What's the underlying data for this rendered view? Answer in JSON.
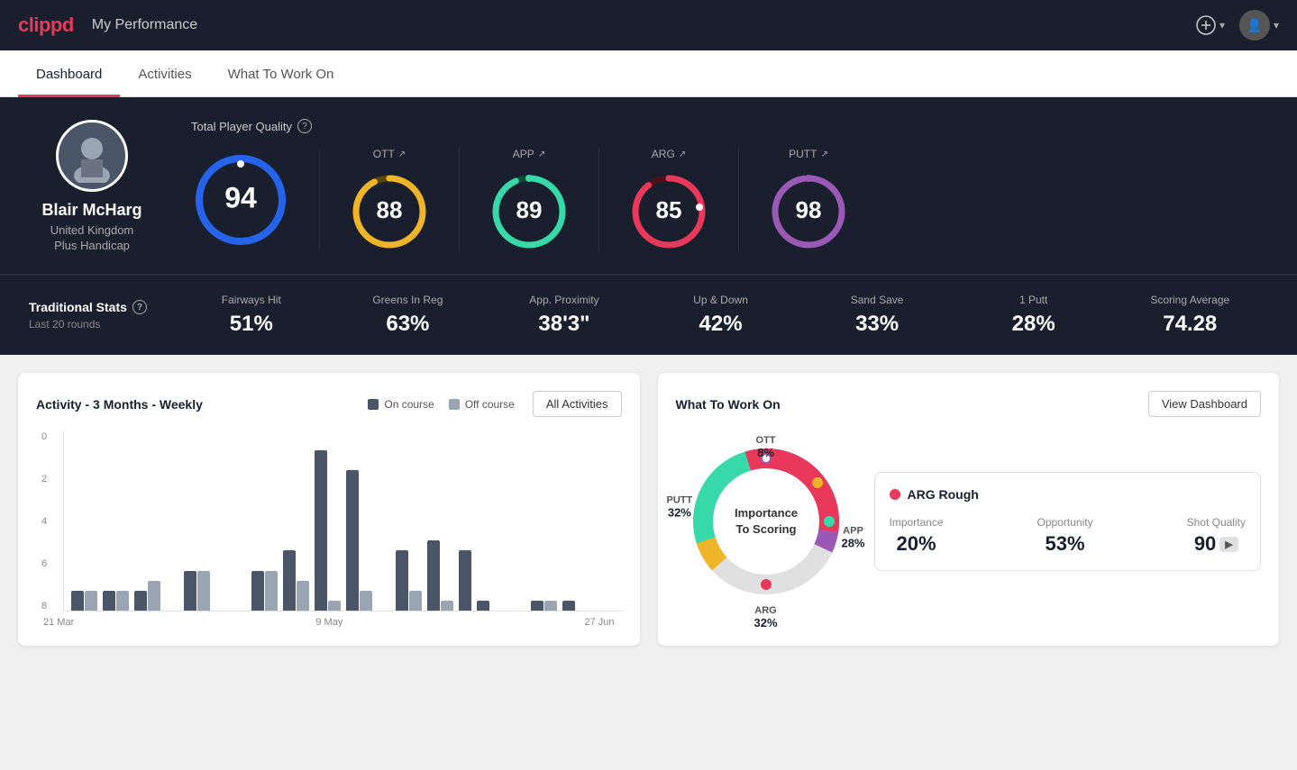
{
  "app": {
    "logo": "clippd",
    "header_title": "My Performance"
  },
  "tabs": [
    {
      "id": "dashboard",
      "label": "Dashboard",
      "active": true
    },
    {
      "id": "activities",
      "label": "Activities",
      "active": false
    },
    {
      "id": "what_to_work_on",
      "label": "What To Work On",
      "active": false
    }
  ],
  "player": {
    "name": "Blair McHarg",
    "country": "United Kingdom",
    "handicap": "Plus Handicap"
  },
  "total_quality": {
    "label": "Total Player Quality",
    "value": 94
  },
  "metrics": [
    {
      "id": "ott",
      "label": "OTT",
      "value": 88,
      "color": "#f0b429",
      "track_color": "#5a4500",
      "pct": 88
    },
    {
      "id": "app",
      "label": "APP",
      "value": 89,
      "color": "#38d9a9",
      "track_color": "#0d4a3a",
      "pct": 89
    },
    {
      "id": "arg",
      "label": "ARG",
      "value": 85,
      "color": "#e8395a",
      "track_color": "#4a1020",
      "pct": 85
    },
    {
      "id": "putt",
      "label": "PUTT",
      "value": 98,
      "color": "#9b59b6",
      "track_color": "#3d1a5a",
      "pct": 98
    }
  ],
  "traditional_stats": {
    "title": "Traditional Stats",
    "subtitle": "Last 20 rounds",
    "items": [
      {
        "id": "fairways",
        "label": "Fairways Hit",
        "value": "51%"
      },
      {
        "id": "greens",
        "label": "Greens In Reg",
        "value": "63%"
      },
      {
        "id": "proximity",
        "label": "App. Proximity",
        "value": "38'3\""
      },
      {
        "id": "updown",
        "label": "Up & Down",
        "value": "42%"
      },
      {
        "id": "sand",
        "label": "Sand Save",
        "value": "33%"
      },
      {
        "id": "oneputt",
        "label": "1 Putt",
        "value": "28%"
      },
      {
        "id": "scoring",
        "label": "Scoring Average",
        "value": "74.28"
      }
    ]
  },
  "activity_chart": {
    "title": "Activity - 3 Months - Weekly",
    "legend": [
      {
        "id": "oncourse",
        "label": "On course",
        "color": "#4a5568"
      },
      {
        "id": "offcourse",
        "label": "Off course",
        "color": "#9aa5b4"
      }
    ],
    "all_activities_btn": "All Activities",
    "x_labels": [
      "21 Mar",
      "9 May",
      "27 Jun"
    ],
    "y_labels": [
      "0",
      "2",
      "4",
      "6",
      "8"
    ],
    "bars": [
      {
        "on": 1,
        "off": 1
      },
      {
        "on": 1,
        "off": 1
      },
      {
        "on": 1,
        "off": 1.5
      },
      {
        "on": 0,
        "off": 0
      },
      {
        "on": 2,
        "off": 2
      },
      {
        "on": 0,
        "off": 0
      },
      {
        "on": 0,
        "off": 0
      },
      {
        "on": 2,
        "off": 2
      },
      {
        "on": 3,
        "off": 1.5
      },
      {
        "on": 8,
        "off": 0.5
      },
      {
        "on": 7,
        "off": 1
      },
      {
        "on": 0,
        "off": 0
      },
      {
        "on": 3,
        "off": 1
      },
      {
        "on": 3.5,
        "off": 0.5
      },
      {
        "on": 3,
        "off": 0
      },
      {
        "on": 0.5,
        "off": 0
      },
      {
        "on": 0,
        "off": 0
      },
      {
        "on": 0,
        "off": 0
      },
      {
        "on": 0.5,
        "off": 0.5
      },
      {
        "on": 0.5,
        "off": 0
      }
    ]
  },
  "what_to_work_on": {
    "title": "What To Work On",
    "view_dashboard_btn": "View Dashboard",
    "center_label_line1": "Importance",
    "center_label_line2": "To Scoring",
    "segments": [
      {
        "id": "ott",
        "label": "OTT",
        "pct": "8%",
        "color": "#f0b429"
      },
      {
        "id": "app",
        "label": "APP",
        "pct": "28%",
        "color": "#38d9a9"
      },
      {
        "id": "arg",
        "label": "ARG",
        "pct": "32%",
        "color": "#e8395a"
      },
      {
        "id": "putt",
        "label": "PUTT",
        "pct": "32%",
        "color": "#9b59b6"
      }
    ],
    "detail": {
      "title": "ARG Rough",
      "importance_label": "Importance",
      "importance_value": "20%",
      "opportunity_label": "Opportunity",
      "opportunity_value": "53%",
      "shot_quality_label": "Shot Quality",
      "shot_quality_value": "90"
    }
  }
}
